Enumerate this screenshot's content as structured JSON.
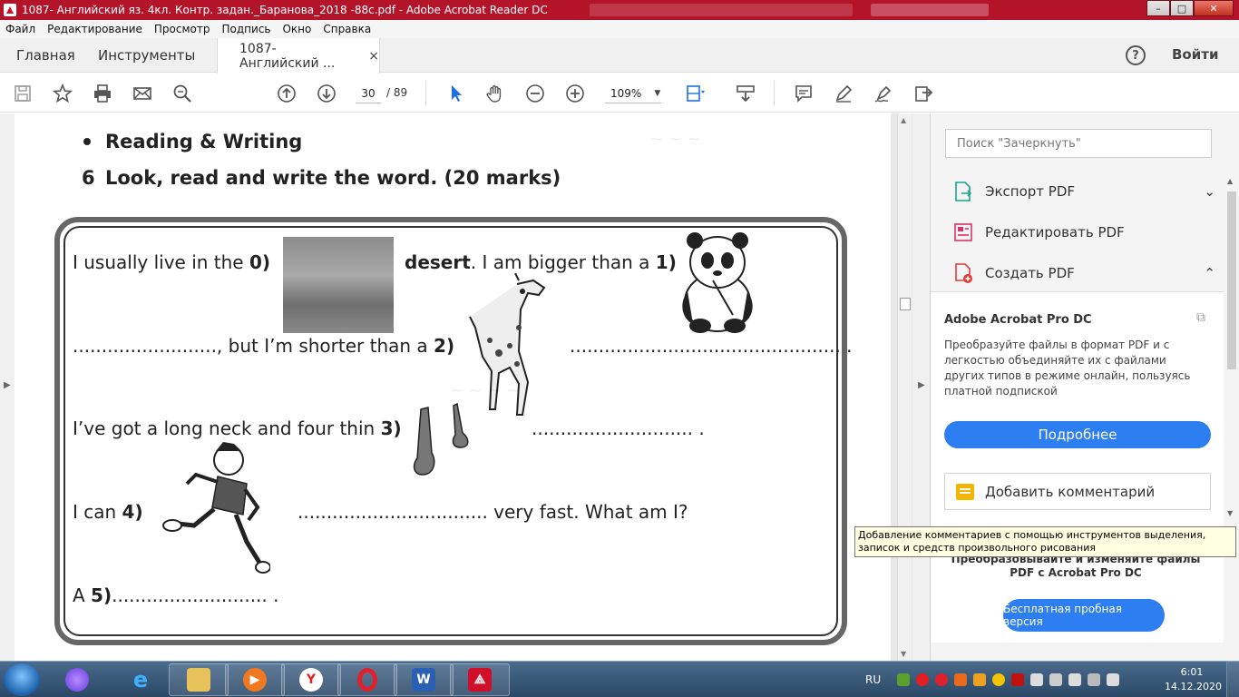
{
  "window": {
    "title": "1087- Английский яз. 4кл. Контр. задан._Баранова_2018 -88с.pdf - Adobe Acrobat Reader DC",
    "minimize": "–",
    "maximize": "□",
    "close": "✕"
  },
  "menu": [
    "Файл",
    "Редактирование",
    "Просмотр",
    "Подпись",
    "Окно",
    "Справка"
  ],
  "tabs": {
    "home": "Главная",
    "tools": "Инструменты",
    "document": "1087- Английский ...",
    "close": "×",
    "sign_in": "Войти",
    "help": "?"
  },
  "toolbar": {
    "current_page": "30",
    "total_pages": "/ 89",
    "zoom": "109%",
    "icons": [
      "save-icon",
      "bookmark-star-icon",
      "print-icon",
      "email-icon",
      "zoom-search-icon",
      "page-up-icon",
      "page-down-icon",
      "select-arrow-icon",
      "hand-icon",
      "zoom-out-icon",
      "zoom-in-icon",
      "fit-page-icon",
      "scroll-mode-icon",
      "comment-icon",
      "highlight-pen-icon",
      "sign-icon",
      "share-icon"
    ]
  },
  "document": {
    "heading_reading": "Reading & Writing",
    "task_number": "6",
    "task_text": "Look, read and write the word. (20 marks)",
    "lines": {
      "l0_pre": "I usually live in the ",
      "l0_num": "0)",
      "l0_answer": "desert",
      "l0_post": ". I am bigger than a ",
      "l1_num": "1)",
      "l2_pre": "........................., but I’m shorter than a ",
      "l2_num": "2)",
      "l2_dots": "............................................... .",
      "l3_pre": "I’ve got a long neck and four thin ",
      "l3_num": "3)",
      "l3_dots": "............................ .",
      "l4_pre": "I can ",
      "l4_num": "4)",
      "l4_dots": "................................. very fast. What am I?",
      "l5_pre": "A ",
      "l5_num": "5)",
      "l5_dots": "........................... ."
    }
  },
  "panel": {
    "search_placeholder": "Поиск \"Зачеркнуть\"",
    "items": [
      {
        "label": "Экспорт PDF",
        "chevron": "⌄"
      },
      {
        "label": "Редактировать PDF",
        "chevron": ""
      },
      {
        "label": "Создать PDF",
        "chevron": "⌃"
      }
    ],
    "promo_title": "Adobe Acrobat Pro DC",
    "promo_text": "Преобразуйте файлы в формат PDF и с легкостью объединяйте их с файлами других типов в режиме онлайн, пользуясь платной подпиской",
    "more_button": "Подробнее",
    "add_comment": "Добавить комментарий",
    "promo2_title": "Преобразовывайте и изменяйте файлы PDF с Acrobat Pro DC",
    "trial_button": "Бесплатная пробная версия"
  },
  "tooltip": "Добавление комментариев с помощью инструментов выделения, записок и средств произвольного рисования",
  "taskbar": {
    "apps": [
      "cortana-icon",
      "internet-explorer-icon",
      "file-explorer-icon",
      "media-player-icon",
      "yandex-browser-icon",
      "opera-icon",
      "word-icon",
      "acrobat-icon"
    ],
    "word_label": "W",
    "lang": "RU",
    "time": "6:01",
    "date": "14.12.2020"
  },
  "colors": {
    "titlebar": "#b4142a",
    "accent_blue": "#2d7ef0",
    "tooltip_bg": "#ffffe1"
  }
}
